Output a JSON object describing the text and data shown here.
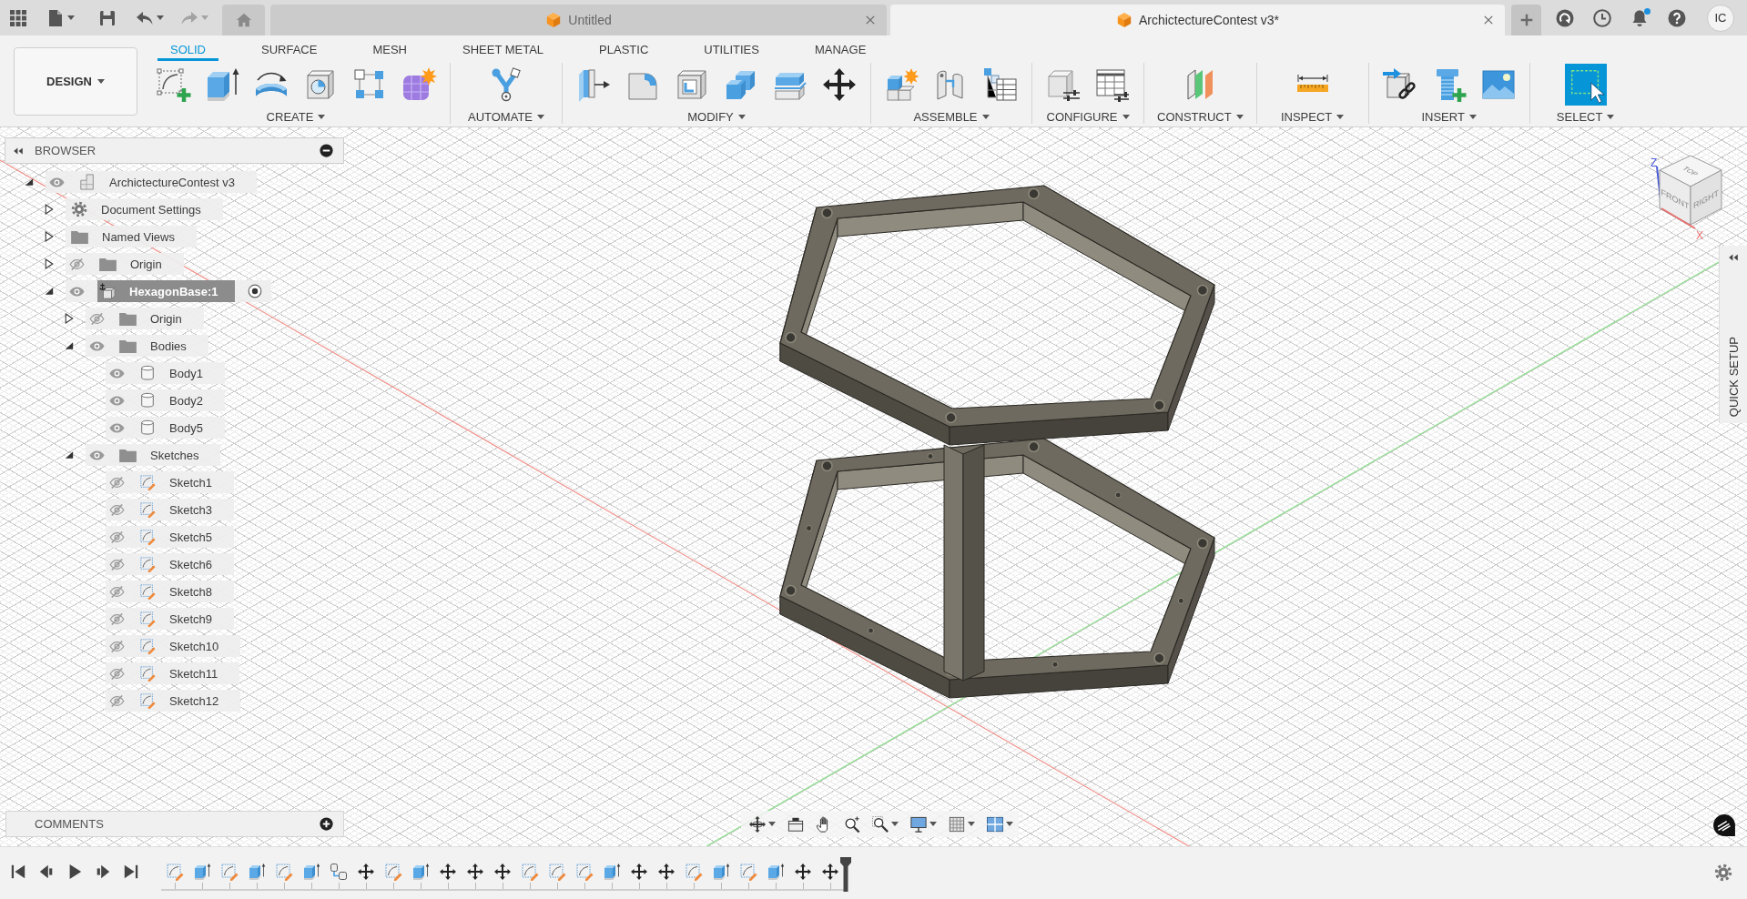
{
  "top_bar": {
    "history": {
      "undo_disabled": false,
      "redo_disabled": true
    },
    "tabs": [
      {
        "title": "Untitled",
        "selected": false
      },
      {
        "title": "ArchictectureContest v3*",
        "selected": true
      }
    ],
    "notifications": {
      "unread": true
    },
    "user": {
      "initials": "IC"
    }
  },
  "toolbar": {
    "workspace": {
      "label": "DESIGN"
    },
    "tabs": [
      {
        "label": "SOLID",
        "selected": true
      },
      {
        "label": "SURFACE",
        "selected": false
      },
      {
        "label": "MESH",
        "selected": false
      },
      {
        "label": "SHEET METAL",
        "selected": false
      },
      {
        "label": "PLASTIC",
        "selected": false
      },
      {
        "label": "UTILITIES",
        "selected": false
      },
      {
        "label": "MANAGE",
        "selected": false
      }
    ],
    "groups": [
      {
        "label": "CREATE"
      },
      {
        "label": "AUTOMATE"
      },
      {
        "label": "MODIFY"
      },
      {
        "label": "ASSEMBLE"
      },
      {
        "label": "CONFIGURE"
      },
      {
        "label": "CONSTRUCT"
      },
      {
        "label": "INSPECT"
      },
      {
        "label": "INSERT"
      },
      {
        "label": "SELECT"
      }
    ]
  },
  "browser": {
    "title": "BROWSER",
    "tree": [
      {
        "label": "ArchictectureContest v3",
        "kind": "document",
        "visible": true,
        "expanded": true,
        "selected": false,
        "children": [
          {
            "label": "Document Settings",
            "kind": "settings",
            "expanded": false,
            "selected": false
          },
          {
            "label": "Named Views",
            "kind": "folder",
            "expanded": false,
            "selected": false
          },
          {
            "label": "Origin",
            "kind": "folder",
            "visible": false,
            "expanded": false,
            "selected": false
          },
          {
            "label": "HexagonBase:1",
            "kind": "component",
            "visible": true,
            "expanded": true,
            "selected": true,
            "active": true,
            "children": [
              {
                "label": "Origin",
                "kind": "folder",
                "visible": false,
                "expanded": false,
                "selected": false
              },
              {
                "label": "Bodies",
                "kind": "folder",
                "visible": true,
                "expanded": true,
                "selected": false,
                "children": [
                  {
                    "label": "Body1",
                    "kind": "body",
                    "visible": true,
                    "selected": false
                  },
                  {
                    "label": "Body2",
                    "kind": "body",
                    "visible": true,
                    "selected": false
                  },
                  {
                    "label": "Body5",
                    "kind": "body",
                    "visible": true,
                    "selected": false
                  }
                ]
              },
              {
                "label": "Sketches",
                "kind": "folder",
                "visible": true,
                "expanded": true,
                "selected": false,
                "children": [
                  {
                    "label": "Sketch1",
                    "kind": "sketch",
                    "visible": false,
                    "selected": false
                  },
                  {
                    "label": "Sketch3",
                    "kind": "sketch",
                    "visible": false,
                    "selected": false
                  },
                  {
                    "label": "Sketch5",
                    "kind": "sketch",
                    "visible": false,
                    "selected": false
                  },
                  {
                    "label": "Sketch6",
                    "kind": "sketch",
                    "visible": false,
                    "selected": false
                  },
                  {
                    "label": "Sketch8",
                    "kind": "sketch",
                    "visible": false,
                    "selected": false
                  },
                  {
                    "label": "Sketch9",
                    "kind": "sketch",
                    "visible": false,
                    "selected": false
                  },
                  {
                    "label": "Sketch10",
                    "kind": "sketch",
                    "visible": false,
                    "selected": false
                  },
                  {
                    "label": "Sketch11",
                    "kind": "sketch",
                    "visible": false,
                    "selected": false
                  },
                  {
                    "label": "Sketch12",
                    "kind": "sketch",
                    "visible": false,
                    "selected": false
                  }
                ]
              }
            ]
          }
        ]
      }
    ]
  },
  "comments": {
    "title": "COMMENTS"
  },
  "view_cube": {
    "faces": {
      "top": "TOP",
      "front": "FRONT",
      "right": "RIGHT"
    },
    "axes": {
      "vertical": "Z",
      "horizontal": "X"
    }
  },
  "quick_setup": {
    "title": "QUICK SETUP"
  },
  "timeline": {
    "features": [
      {
        "kind": "sketch"
      },
      {
        "kind": "extrude"
      },
      {
        "kind": "sketch"
      },
      {
        "kind": "extrude"
      },
      {
        "kind": "sketch"
      },
      {
        "kind": "extrude"
      },
      {
        "kind": "rigid_group"
      },
      {
        "kind": "move"
      },
      {
        "kind": "sketch"
      },
      {
        "kind": "extrude"
      },
      {
        "kind": "move"
      },
      {
        "kind": "move"
      },
      {
        "kind": "move"
      },
      {
        "kind": "sketch"
      },
      {
        "kind": "sketch"
      },
      {
        "kind": "sketch"
      },
      {
        "kind": "extrude"
      },
      {
        "kind": "move"
      },
      {
        "kind": "move"
      },
      {
        "kind": "sketch"
      },
      {
        "kind": "extrude"
      },
      {
        "kind": "sketch"
      },
      {
        "kind": "extrude"
      },
      {
        "kind": "move"
      },
      {
        "kind": "move"
      }
    ]
  }
}
